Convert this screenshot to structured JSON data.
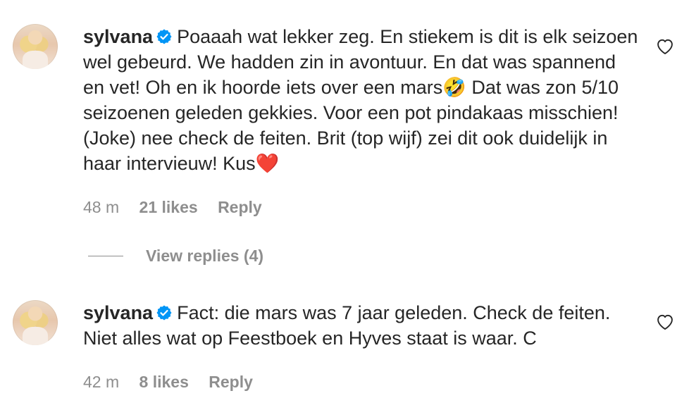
{
  "comments": [
    {
      "username": "sylvana",
      "text": "Poaaah wat lekker zeg. En stiekem is dit is elk seizoen wel gebeurd. We hadden zin in avontuur. En dat was spannend en vet! Oh en ik hoorde iets over een mars🤣 Dat was zon 5/10 seizoenen geleden gekkies. Voor een pot pindakaas misschien! (Joke) nee check de feiten. Brit (top wijf) zei dit ook duidelijk in haar intervieuw! Kus❤️",
      "time": "48 m",
      "likes": "21 likes",
      "reply_label": "Reply",
      "view_replies": "View replies (4)"
    },
    {
      "username": "sylvana",
      "text": "Fact: die mars was 7 jaar geleden. Check de feiten. Niet alles wat op Feestboek en Hyves staat is waar. C",
      "time": "42 m",
      "likes": "8 likes",
      "reply_label": "Reply"
    }
  ],
  "icons": {
    "verified": "verified-badge-icon",
    "like": "heart-outline-icon"
  },
  "colors": {
    "verified_blue": "#0095f6",
    "meta_gray": "#8e8e8e",
    "text": "#262626"
  }
}
